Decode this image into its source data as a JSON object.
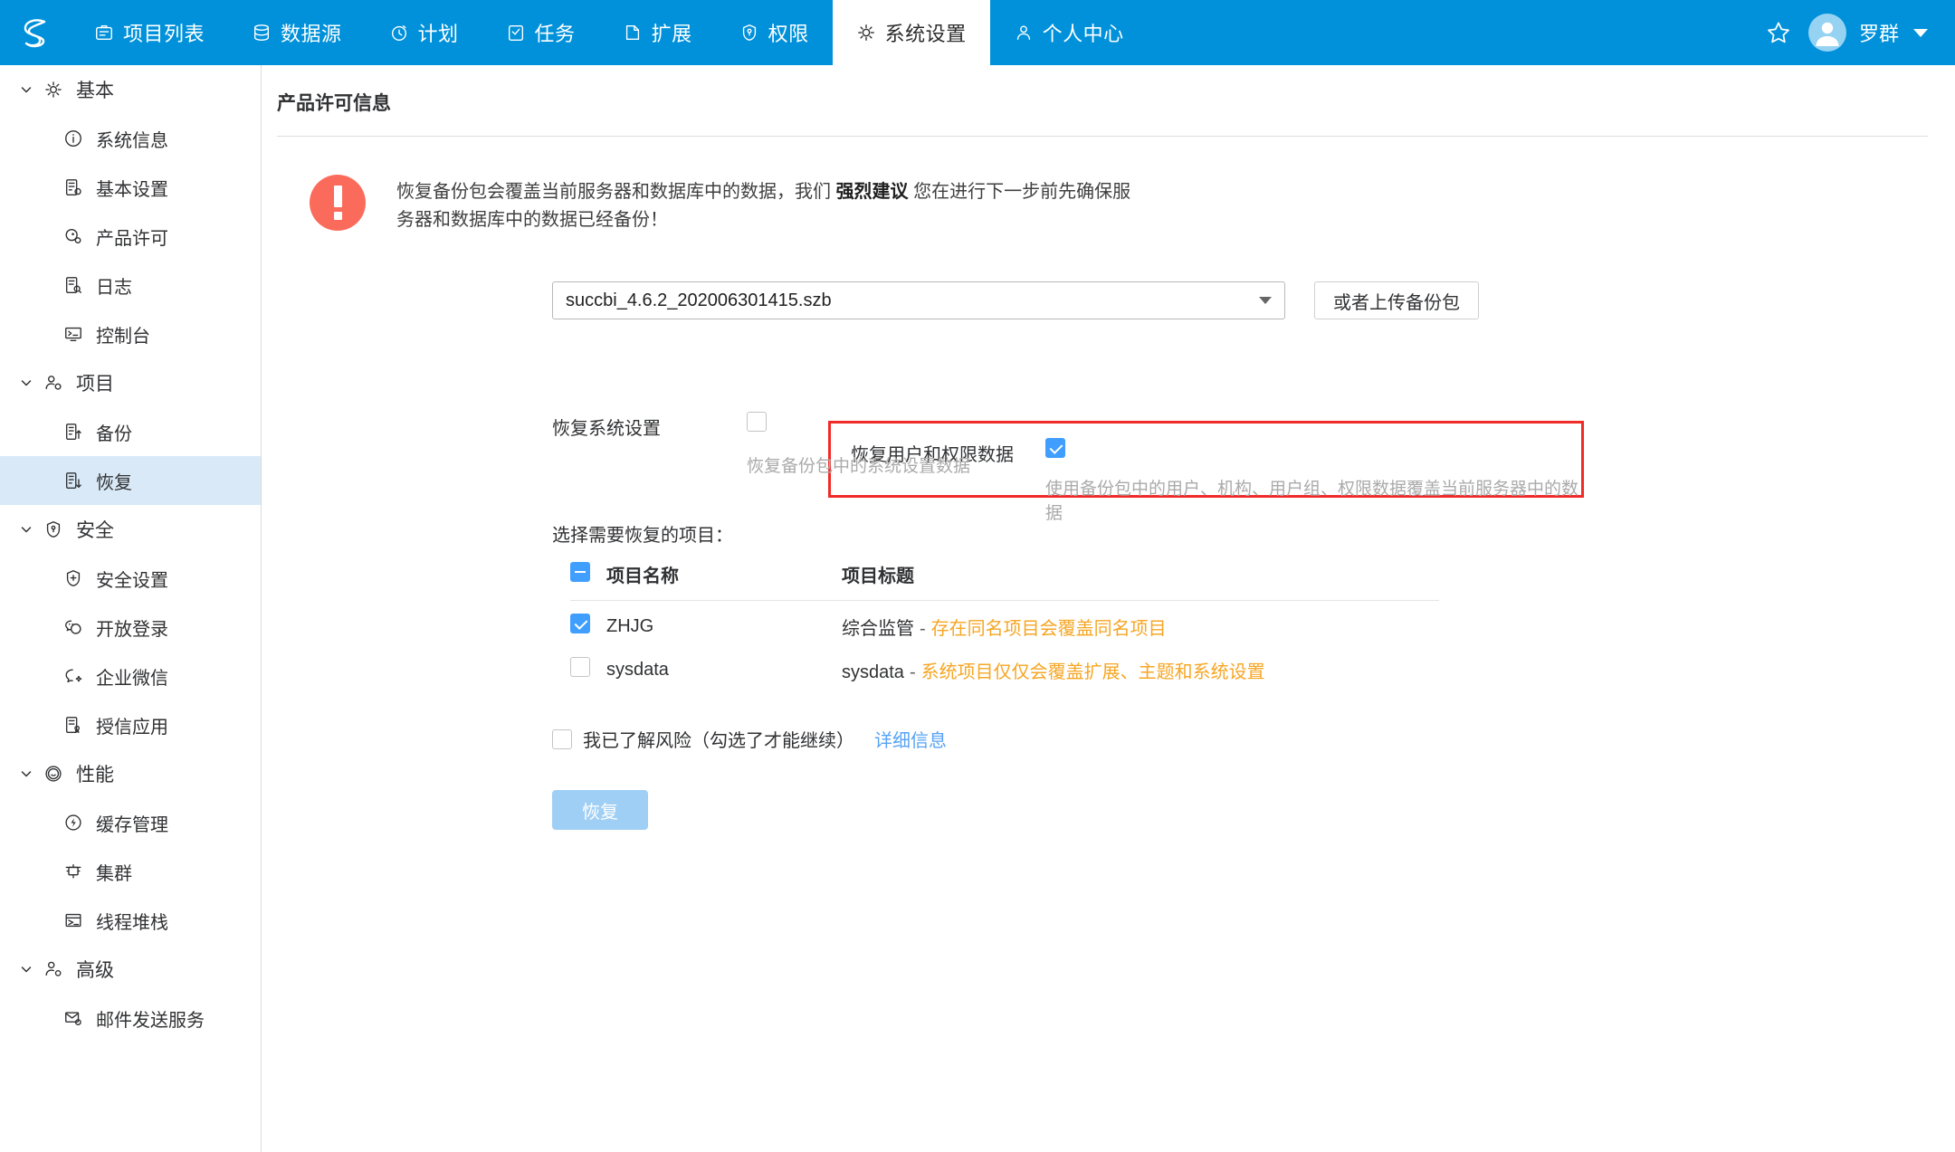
{
  "topnav": {
    "logo_name": "succbi-logo",
    "items": [
      {
        "label": "项目列表",
        "icon": "projects-icon",
        "active": false
      },
      {
        "label": "数据源",
        "icon": "database-icon",
        "active": false
      },
      {
        "label": "计划",
        "icon": "clock-icon",
        "active": false
      },
      {
        "label": "任务",
        "icon": "task-icon",
        "active": false
      },
      {
        "label": "扩展",
        "icon": "extension-icon",
        "active": false
      },
      {
        "label": "权限",
        "icon": "shield-icon",
        "active": false
      },
      {
        "label": "系统设置",
        "icon": "gear-icon",
        "active": true
      },
      {
        "label": "个人中心",
        "icon": "user-icon",
        "active": false
      }
    ],
    "star_icon": "star-icon",
    "user_name": "罗群",
    "avatar_icon": "avatar-icon",
    "caret_icon": "chevron-down-icon",
    "brand_color": "#0091DA"
  },
  "sidebar": {
    "groups": [
      {
        "label": "基本",
        "icon": "gear-icon",
        "expanded": true,
        "items": [
          {
            "label": "系统信息",
            "icon": "info-icon",
            "active": false
          },
          {
            "label": "基本设置",
            "icon": "doc-gear-icon",
            "active": false
          },
          {
            "label": "产品许可",
            "icon": "license-icon",
            "active": false
          },
          {
            "label": "日志",
            "icon": "doc-search-icon",
            "active": false
          },
          {
            "label": "控制台",
            "icon": "console-icon",
            "active": false
          }
        ]
      },
      {
        "label": "项目",
        "icon": "user-gear-icon",
        "expanded": true,
        "items": [
          {
            "label": "备份",
            "icon": "doc-up-icon",
            "active": false
          },
          {
            "label": "恢复",
            "icon": "doc-down-icon",
            "active": true
          }
        ]
      },
      {
        "label": "安全",
        "icon": "shield-key-icon",
        "expanded": true,
        "items": [
          {
            "label": "安全设置",
            "icon": "shield-plus-icon",
            "active": false
          },
          {
            "label": "开放登录",
            "icon": "wechat-icon",
            "active": false
          },
          {
            "label": "企业微信",
            "icon": "chat-icon",
            "active": false
          },
          {
            "label": "授信应用",
            "icon": "doc-cert-icon",
            "active": false
          }
        ]
      },
      {
        "label": "性能",
        "icon": "gauge-icon",
        "expanded": true,
        "items": [
          {
            "label": "缓存管理",
            "icon": "flash-icon",
            "active": false
          },
          {
            "label": "集群",
            "icon": "cluster-icon",
            "active": false
          },
          {
            "label": "线程堆栈",
            "icon": "stack-icon",
            "active": false
          }
        ]
      },
      {
        "label": "高级",
        "icon": "user-advanced-icon",
        "expanded": true,
        "items": [
          {
            "label": "邮件发送服务",
            "icon": "mail-gear-icon",
            "active": false
          }
        ]
      }
    ]
  },
  "main": {
    "page_title": "产品许可信息",
    "alert": {
      "icon": "alert-exclamation-icon",
      "color": "#FB6B5B",
      "text_part1": "恢复备份包会覆盖当前服务器和数据库中的数据，我们 ",
      "text_strong": "强烈建议",
      "text_part2": " 您在进行下一步前先确保服务器和数据库中的数据已经备份！"
    },
    "backup_select": {
      "value": "succbi_4.6.2_202006301415.szb",
      "caret_icon": "chevron-down-icon"
    },
    "upload_button": "或者上传备份包",
    "options": [
      {
        "label": "恢复用户和权限数据",
        "checked": true,
        "hint": "使用备份包中的用户、机构、用户组、权限数据覆盖当前服务器中的数据",
        "highlighted": true,
        "highlight_color": "#F02B28"
      },
      {
        "label": "恢复系统设置",
        "checked": false,
        "hint": "恢复备份包中的系统设置数据",
        "highlighted": false
      }
    ],
    "projects_section_label": "选择需要恢复的项目：",
    "projects_table": {
      "header_checkbox_state": "indeterminate",
      "columns": [
        "项目名称",
        "项目标题"
      ],
      "rows": [
        {
          "checked": true,
          "name": "ZHJG",
          "title": "综合监管",
          "dash": "-",
          "warn": "存在同名项目会覆盖同名项目"
        },
        {
          "checked": false,
          "name": "sysdata",
          "title": "sysdata",
          "dash": "-",
          "warn": "系统项目仅仅会覆盖扩展、主题和系统设置"
        }
      ],
      "warn_color": "#F6A623"
    },
    "acknowledge": {
      "checked": false,
      "label": "我已了解风险（勾选了才能继续）",
      "link": "详细信息"
    },
    "restore_button": "恢复"
  }
}
